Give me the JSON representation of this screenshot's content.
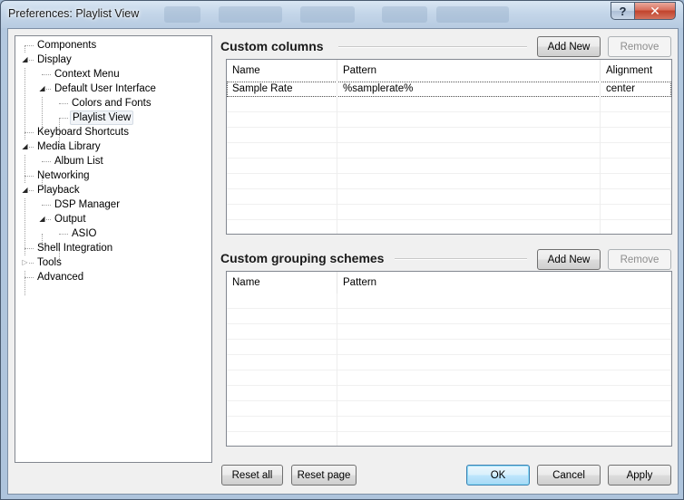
{
  "window": {
    "title": "Preferences: Playlist View",
    "help_glyph": "?",
    "close_glyph": "✕"
  },
  "tree": {
    "items": [
      {
        "label": "Components",
        "level": 0,
        "expander": ""
      },
      {
        "label": "Display",
        "level": 0,
        "expander": "expanded"
      },
      {
        "label": "Context Menu",
        "level": 1,
        "expander": ""
      },
      {
        "label": "Default User Interface",
        "level": 1,
        "expander": "expanded"
      },
      {
        "label": "Colors and Fonts",
        "level": 2,
        "expander": ""
      },
      {
        "label": "Playlist View",
        "level": 2,
        "expander": "",
        "selected": true
      },
      {
        "label": "Keyboard Shortcuts",
        "level": 0,
        "expander": ""
      },
      {
        "label": "Media Library",
        "level": 0,
        "expander": "expanded"
      },
      {
        "label": "Album List",
        "level": 1,
        "expander": ""
      },
      {
        "label": "Networking",
        "level": 0,
        "expander": ""
      },
      {
        "label": "Playback",
        "level": 0,
        "expander": "expanded"
      },
      {
        "label": "DSP Manager",
        "level": 1,
        "expander": ""
      },
      {
        "label": "Output",
        "level": 1,
        "expander": "expanded"
      },
      {
        "label": "ASIO",
        "level": 2,
        "expander": ""
      },
      {
        "label": "Shell Integration",
        "level": 0,
        "expander": ""
      },
      {
        "label": "Tools",
        "level": 0,
        "expander": "collapsed"
      },
      {
        "label": "Advanced",
        "level": 0,
        "expander": ""
      }
    ]
  },
  "custom_columns": {
    "title": "Custom columns",
    "add_label": "Add New",
    "remove_label": "Remove",
    "headers": [
      "Name",
      "Pattern",
      "Alignment"
    ],
    "rows": [
      [
        "Sample Rate",
        "%samplerate%",
        "center"
      ]
    ]
  },
  "grouping": {
    "title": "Custom grouping schemes",
    "add_label": "Add New",
    "remove_label": "Remove",
    "headers": [
      "Name",
      "Pattern"
    ],
    "rows": []
  },
  "footer": {
    "reset_all": "Reset all",
    "reset_page": "Reset page",
    "ok": "OK",
    "cancel": "Cancel",
    "apply": "Apply"
  }
}
